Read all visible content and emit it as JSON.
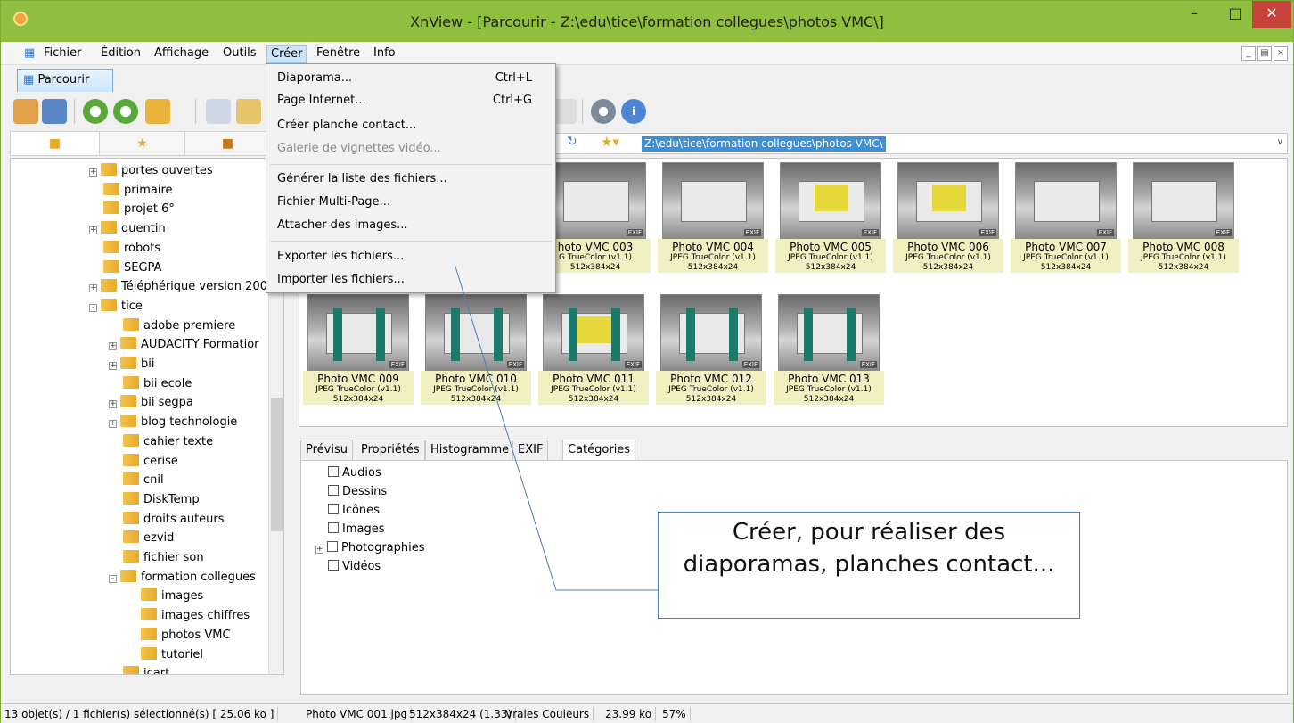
{
  "window": {
    "title": "XnView - [Parcourir - Z:\\edu\\tice\\formation collegues\\photos VMC\\]"
  },
  "menubar": {
    "items": [
      "Fichier",
      "Édition",
      "Affichage",
      "Outils",
      "Créer",
      "Fenêtre",
      "Info"
    ],
    "active": "Créer"
  },
  "tabs": {
    "browse": "Parcourir"
  },
  "address": {
    "path": "Z:\\edu\\tice\\formation collegues\\photos VMC\\"
  },
  "dropdown": {
    "items": [
      {
        "label": "Diaporama...",
        "shortcut": "Ctrl+L"
      },
      {
        "label": "Page Internet...",
        "shortcut": "Ctrl+G"
      },
      {
        "label": "Créer planche contact..."
      },
      {
        "label": "Galerie de vignettes vidéo...",
        "disabled": true
      },
      {
        "label": "Générer la liste des fichiers..."
      },
      {
        "label": "Fichier Multi-Page..."
      },
      {
        "label": "Attacher des images..."
      },
      {
        "label": "Exporter les fichiers..."
      },
      {
        "label": "Importer les fichiers..."
      }
    ]
  },
  "tree": {
    "items": [
      "portes ouvertes",
      "primaire",
      "projet 6°",
      "quentin",
      "robots",
      "SEGPA",
      "Téléphérique version 200",
      "tice",
      "adobe premiere",
      "AUDACITY Formatior",
      "bii",
      "bii ecole",
      "bii segpa",
      "blog technologie",
      "cahier texte",
      "cerise",
      "cnil",
      "DiskTemp",
      "droits auteurs",
      "ezvid",
      "fichier son",
      "formation collegues",
      "images",
      "images chiffres",
      "photos VMC",
      "tutoriel",
      "icart"
    ]
  },
  "thumbnails": {
    "items": [
      {
        "name": "hoto VMC 003",
        "type": "G TrueColor (v1.1)",
        "size": "512x384x24"
      },
      {
        "name": "Photo VMC 004",
        "type": "JPEG TrueColor (v1.1)",
        "size": "512x384x24"
      },
      {
        "name": "Photo VMC 005",
        "type": "JPEG TrueColor (v1.1)",
        "size": "512x384x24"
      },
      {
        "name": "Photo VMC 006",
        "type": "JPEG TrueColor (v1.1)",
        "size": "512x384x24"
      },
      {
        "name": "Photo VMC 007",
        "type": "JPEG TrueColor (v1.1)",
        "size": "512x384x24"
      },
      {
        "name": "Photo VMC 008",
        "type": "JPEG TrueColor (v1.1)",
        "size": "512x384x24"
      },
      {
        "name": "Photo VMC 009",
        "type": "JPEG TrueColor (v1.1)",
        "size": "512x384x24"
      },
      {
        "name": "Photo VMC 010",
        "type": "JPEG TrueColor (v1.1)",
        "size": "512x384x24"
      },
      {
        "name": "Photo VMC 011",
        "type": "JPEG TrueColor (v1.1)",
        "size": "512x384x24"
      },
      {
        "name": "Photo VMC 012",
        "type": "JPEG TrueColor (v1.1)",
        "size": "512x384x24"
      },
      {
        "name": "Photo VMC 013",
        "type": "JPEG TrueColor (v1.1)",
        "size": "512x384x24"
      }
    ],
    "exif_badge": "EXIF"
  },
  "bottom_tabs": [
    "Prévisu",
    "Propriétés",
    "Histogramme",
    "EXIF",
    "Catégories"
  ],
  "categories": [
    "Audios",
    "Dessins",
    "Icônes",
    "Images",
    "Photographies",
    "Vidéos"
  ],
  "status": {
    "selection": "13 objet(s) / 1 fichier(s) sélectionné(s)  [ 25.06 ko ]",
    "file": "Photo VMC 001.jpg",
    "dims": "512x384x24 (1.33)",
    "colors": "Vraies Couleurs",
    "filesize": "23.99 ko",
    "zoom": "57%"
  },
  "callout": {
    "text": "Créer, pour réaliser des diaporamas, planches contact..."
  },
  "colors": {
    "titlebar": "#8fbf3e",
    "close": "#c7433a",
    "selection": "#3d8fd8"
  }
}
